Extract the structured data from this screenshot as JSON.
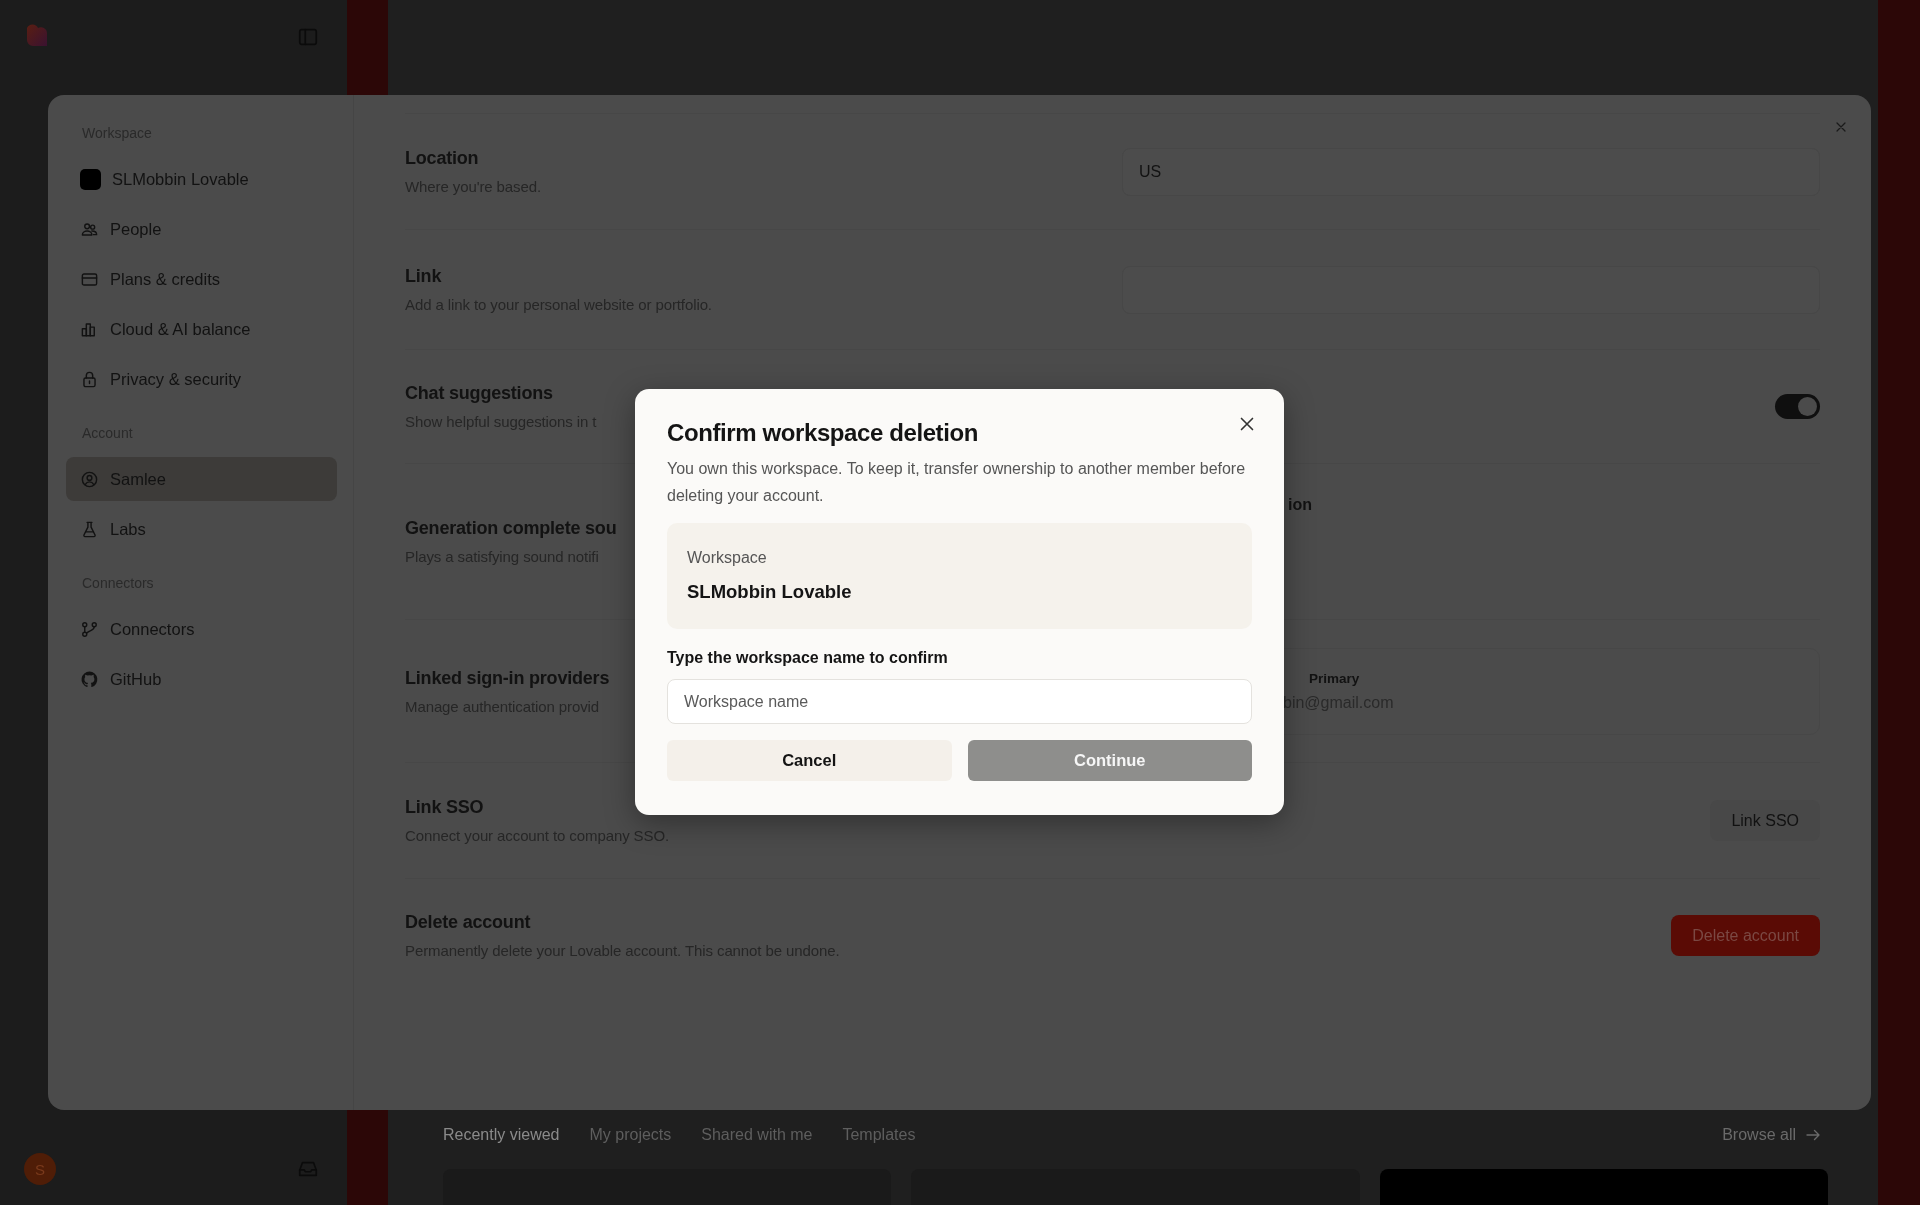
{
  "background": {
    "tabs": [
      {
        "label": "Recently viewed",
        "selected": true
      },
      {
        "label": "My projects",
        "selected": false
      },
      {
        "label": "Shared with me",
        "selected": false
      },
      {
        "label": "Templates",
        "selected": false
      }
    ],
    "browse_all": "Browse all",
    "avatar": "S"
  },
  "settings": {
    "sidebar": [
      {
        "heading": "Workspace",
        "items": [
          {
            "label": "SLMobbin Lovable",
            "kind": "workspace",
            "selected": false
          },
          {
            "label": "People",
            "kind": "people",
            "selected": false
          },
          {
            "label": "Plans & credits",
            "kind": "card",
            "selected": false
          },
          {
            "label": "Cloud & AI balance",
            "kind": "chart",
            "selected": false
          },
          {
            "label": "Privacy & security",
            "kind": "lock",
            "selected": false
          }
        ]
      },
      {
        "heading": "Account",
        "items": [
          {
            "label": "Samlee",
            "kind": "person",
            "selected": true
          },
          {
            "label": "Labs",
            "kind": "flask",
            "selected": false
          }
        ]
      },
      {
        "heading": "Connectors",
        "items": [
          {
            "label": "Connectors",
            "kind": "connectors",
            "selected": false
          },
          {
            "label": "GitHub",
            "kind": "github",
            "selected": false
          }
        ]
      }
    ],
    "sections": [
      {
        "title": "Location",
        "description": "Where you're based.",
        "kind": "input",
        "value": "US"
      },
      {
        "title": "Link",
        "description": "Add a link to your personal website or portfolio.",
        "kind": "input"
      },
      {
        "title": "Chat suggestions",
        "description": "Show helpful suggestions in t",
        "kind": "toggle",
        "on": true
      },
      {
        "title": "Generation complete sou",
        "description": "Plays a satisfying sound notifi",
        "kind": "option",
        "label": "ion"
      },
      {
        "title": "Linked sign-in providers",
        "description": "Manage authentication provid",
        "kind": "provider",
        "badge": "Primary",
        "email": "bin@gmail.com"
      },
      {
        "title": "Link SSO",
        "description": "Connect your account to company SSO.",
        "kind": "button",
        "button": "Link SSO"
      },
      {
        "title": "Delete account",
        "description": "Permanently delete your Lovable account. This cannot be undone.",
        "kind": "danger",
        "button": "Delete account"
      }
    ]
  },
  "dialog": {
    "title": "Confirm workspace deletion",
    "message": "You own this workspace. To keep it, transfer ownership to another member before deleting your account.",
    "workspace_label": "Workspace",
    "workspace_name": "SLMobbin Lovable",
    "confirm_label": "Type the workspace name to confirm",
    "placeholder": "Workspace name",
    "cancel": "Cancel",
    "continue": {
      "label": "Continue",
      "disabled": true
    }
  }
}
